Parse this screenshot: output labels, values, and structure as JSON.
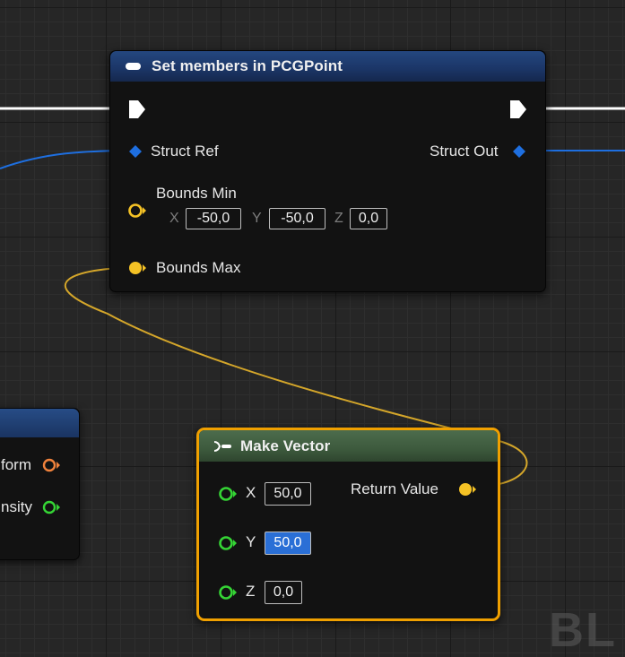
{
  "colors": {
    "exec": "#ffffff",
    "struct": "#1e6fe0",
    "vector": "#f5c225",
    "transform": "#f0823c",
    "float": "#35d435",
    "header_blue": "#1b3566",
    "header_green": "#3d5a3d",
    "selected_outline": "#f0a000"
  },
  "set_members_node": {
    "title": "Set members in PCGPoint",
    "title_icon": "struct-node-icon",
    "pins": {
      "exec_in": "exec-pin-icon",
      "exec_out": "exec-pin-icon",
      "struct_ref": "Struct Ref",
      "struct_out": "Struct Out",
      "bounds_min": "Bounds Min",
      "bounds_max": "Bounds Max"
    },
    "bounds_min": {
      "x_label": "X",
      "x": "-50,0",
      "y_label": "Y",
      "y": "-50,0",
      "z_label": "Z",
      "z": "0,0"
    }
  },
  "make_vector_node": {
    "title": "Make Vector",
    "title_icon": "function-node-icon",
    "return_value": "Return Value",
    "inputs": [
      {
        "label": "X",
        "value": "50,0"
      },
      {
        "label": "Y",
        "value": "50,0",
        "selected": true
      },
      {
        "label": "Z",
        "value": "0,0"
      }
    ]
  },
  "partial_left_node": {
    "pin_transform": "form",
    "pin_density": "nsity"
  },
  "watermark": "BL"
}
